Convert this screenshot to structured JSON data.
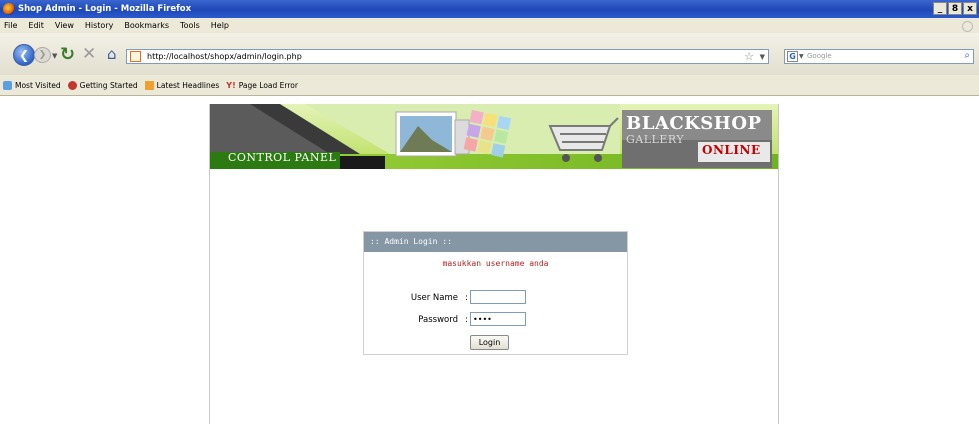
{
  "window": {
    "title": "Shop Admin - Login - Mozilla Firefox",
    "buttons": [
      "_",
      "8",
      "x"
    ]
  },
  "menubar": {
    "items": [
      "File",
      "Edit",
      "View",
      "History",
      "Bookmarks",
      "Tools",
      "Help"
    ]
  },
  "navbar": {
    "url": "http://localhost/shopx/admin/login.php",
    "search_placeholder": "Google"
  },
  "bookmarks": {
    "items": [
      "Most Visited",
      "Getting Started",
      "Latest Headlines",
      "Page Load Error"
    ]
  },
  "banner": {
    "control_panel": "CONTROL PANEL",
    "brand_line1": "BLACKSHOP",
    "brand_line2": "GALLERY",
    "brand_line3": "ONLINE"
  },
  "login": {
    "header": ":: Admin Login ::",
    "message": "masukkan username anda",
    "username_label": "User Name",
    "username_value": "",
    "password_label": "Password",
    "password_value": "aaaa",
    "submit_label": "Login",
    "colon": ":"
  }
}
